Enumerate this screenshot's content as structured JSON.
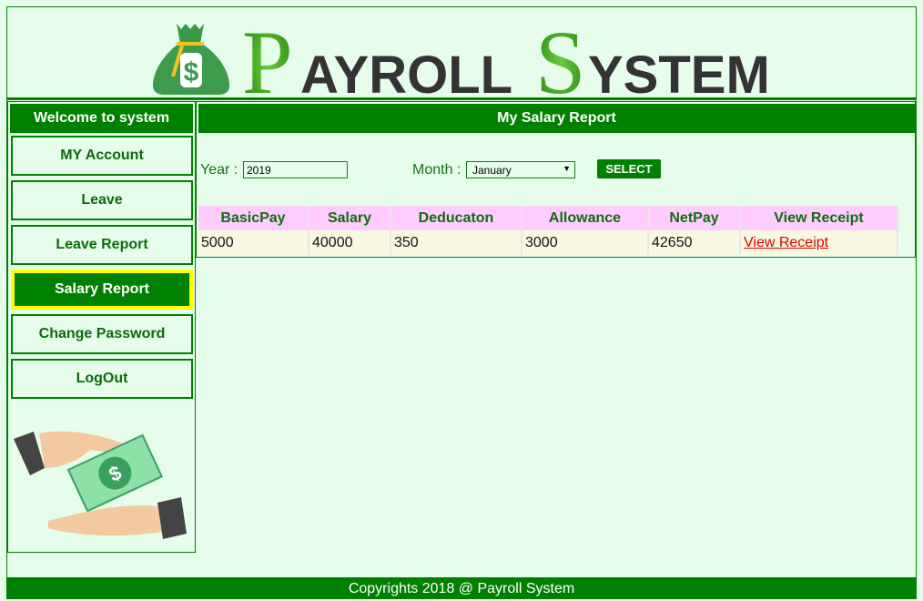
{
  "header": {
    "logo_text": "PAYROLL SYSTEM"
  },
  "sidebar": {
    "title": "Welcome to system",
    "items": [
      {
        "label": "MY Account",
        "active": false
      },
      {
        "label": "Leave",
        "active": false
      },
      {
        "label": "Leave Report",
        "active": false
      },
      {
        "label": "Salary Report",
        "active": true
      },
      {
        "label": "Change Password",
        "active": false
      },
      {
        "label": "LogOut",
        "active": false
      }
    ]
  },
  "main": {
    "title": "My Salary Report",
    "year_label": "Year :",
    "year_value": "2019",
    "month_label": "Month :",
    "month_value": "January",
    "select_label": "SELECT",
    "columns": [
      "BasicPay",
      "Salary",
      "Deducaton",
      "Allowance",
      "NetPay",
      "View Receipt"
    ],
    "row": [
      "5000",
      "40000",
      "350",
      "3000",
      "42650",
      "View Receipt"
    ]
  },
  "footer": {
    "text": "Copyrights 2018 @ Payroll System"
  },
  "colors": {
    "primary": "#008000",
    "active_border": "#ffff00",
    "header_row": "#ffccff",
    "link": "#e00000"
  }
}
